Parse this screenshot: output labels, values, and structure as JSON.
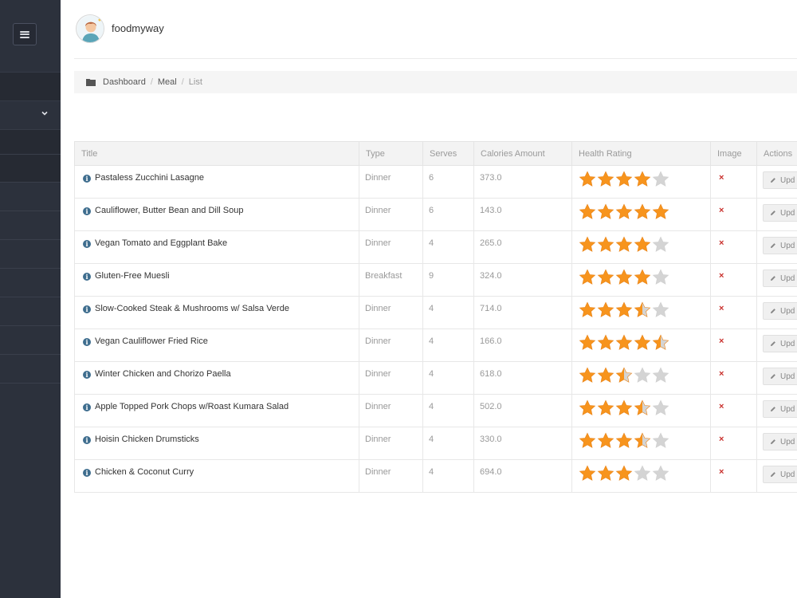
{
  "app": {
    "username": "foodmyway"
  },
  "breadcrumb": {
    "items": [
      "Dashboard",
      "Meal",
      "List"
    ]
  },
  "table": {
    "columns": [
      "Title",
      "Type",
      "Serves",
      "Calories Amount",
      "Health Rating",
      "Image",
      "Actions"
    ],
    "rows": [
      {
        "title": "Pastaless Zucchini Lasagne",
        "type": "Dinner",
        "serves": "6",
        "calories": "373.0",
        "rating": 4,
        "image": "×",
        "action": "Upd"
      },
      {
        "title": "Cauliflower, Butter Bean and Dill Soup",
        "type": "Dinner",
        "serves": "6",
        "calories": "143.0",
        "rating": 5,
        "image": "×",
        "action": "Upd"
      },
      {
        "title": "Vegan Tomato and Eggplant Bake",
        "type": "Dinner",
        "serves": "4",
        "calories": "265.0",
        "rating": 4,
        "image": "×",
        "action": "Upd"
      },
      {
        "title": "Gluten-Free Muesli",
        "type": "Breakfast",
        "serves": "9",
        "calories": "324.0",
        "rating": 4,
        "image": "×",
        "action": "Upd"
      },
      {
        "title": "Slow-Cooked Steak & Mushrooms w/ Salsa Verde",
        "type": "Dinner",
        "serves": "4",
        "calories": "714.0",
        "rating": 3.5,
        "image": "×",
        "action": "Upd"
      },
      {
        "title": "Vegan Cauliflower Fried Rice",
        "type": "Dinner",
        "serves": "4",
        "calories": "166.0",
        "rating": 4.5,
        "image": "×",
        "action": "Upd"
      },
      {
        "title": "Winter Chicken and Chorizo Paella",
        "type": "Dinner",
        "serves": "4",
        "calories": "618.0",
        "rating": 2.5,
        "image": "×",
        "action": "Upd"
      },
      {
        "title": "Apple Topped Pork Chops w/Roast Kumara Salad",
        "type": "Dinner",
        "serves": "4",
        "calories": "502.0",
        "rating": 3.5,
        "image": "×",
        "action": "Upd"
      },
      {
        "title": "Hoisin Chicken Drumsticks",
        "type": "Dinner",
        "serves": "4",
        "calories": "330.0",
        "rating": 3.5,
        "image": "×",
        "action": "Upd"
      },
      {
        "title": "Chicken & Coconut Curry",
        "type": "Dinner",
        "serves": "4",
        "calories": "694.0",
        "rating": 3,
        "image": "×",
        "action": "Upd"
      }
    ]
  },
  "colors": {
    "sidebar": "#2c313c",
    "star_filled": "#f7941d",
    "star_empty": "#d4d4d4",
    "remove": "#c9302c"
  },
  "icons": {
    "menu": "hamburger-icon",
    "expand": "chevron-down-icon",
    "breadcrumb": "folder-icon",
    "info": "info-icon",
    "image_missing": "remove-icon",
    "edit": "pencil-icon"
  }
}
